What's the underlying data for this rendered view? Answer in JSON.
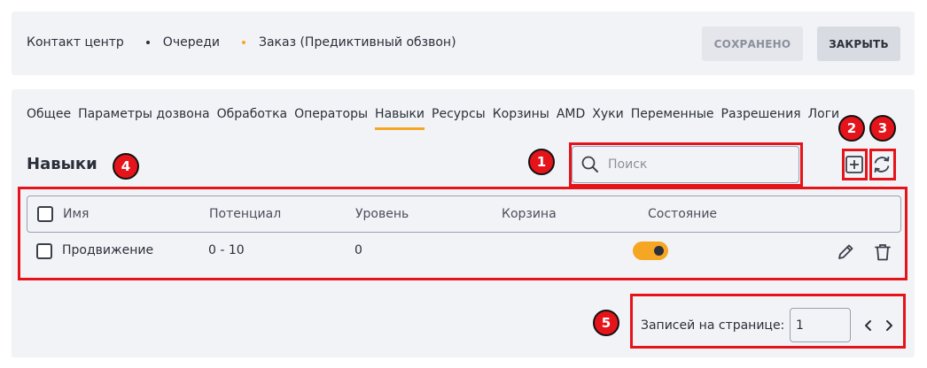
{
  "breadcrumb": [
    {
      "label": "Контакт центр"
    },
    {
      "label": "Очереди",
      "dot_color": "#2b2f3a"
    },
    {
      "label": "Заказ (Предиктивный обзвон)",
      "dot_color": "#f5a623"
    }
  ],
  "header_buttons": {
    "saved": "СОХРАНЕНО",
    "close": "ЗАКРЫТЬ"
  },
  "tabs": [
    {
      "label": "Общее"
    },
    {
      "label": "Параметры дозвона"
    },
    {
      "label": "Обработка"
    },
    {
      "label": "Операторы"
    },
    {
      "label": "Навыки",
      "active": true
    },
    {
      "label": "Ресурсы"
    },
    {
      "label": "Корзины"
    },
    {
      "label": "AMD"
    },
    {
      "label": "Хуки"
    },
    {
      "label": "Переменные"
    },
    {
      "label": "Разрешения"
    },
    {
      "label": "Логи"
    }
  ],
  "section": {
    "title": "Навыки"
  },
  "search": {
    "placeholder": "Поиск",
    "value": ""
  },
  "icons": {
    "add": "plus-square-icon",
    "refresh": "refresh-icon",
    "search": "search-icon",
    "edit": "pencil-icon",
    "delete": "trash-icon"
  },
  "table": {
    "columns": [
      "Имя",
      "Потенциал",
      "Уровень",
      "Корзина",
      "Состояние"
    ],
    "rows": [
      {
        "name": "Продвижение",
        "potential": "0 - 10",
        "level": "0",
        "basket": "",
        "state_on": true
      }
    ]
  },
  "pagination": {
    "label": "Записей на странице:",
    "per_page": "1"
  },
  "annotations": [
    "1",
    "2",
    "3",
    "4",
    "5"
  ],
  "colors": {
    "accent": "#f5a623",
    "annotation": "#e5141a",
    "panel_bg": "#f2f3f7"
  }
}
